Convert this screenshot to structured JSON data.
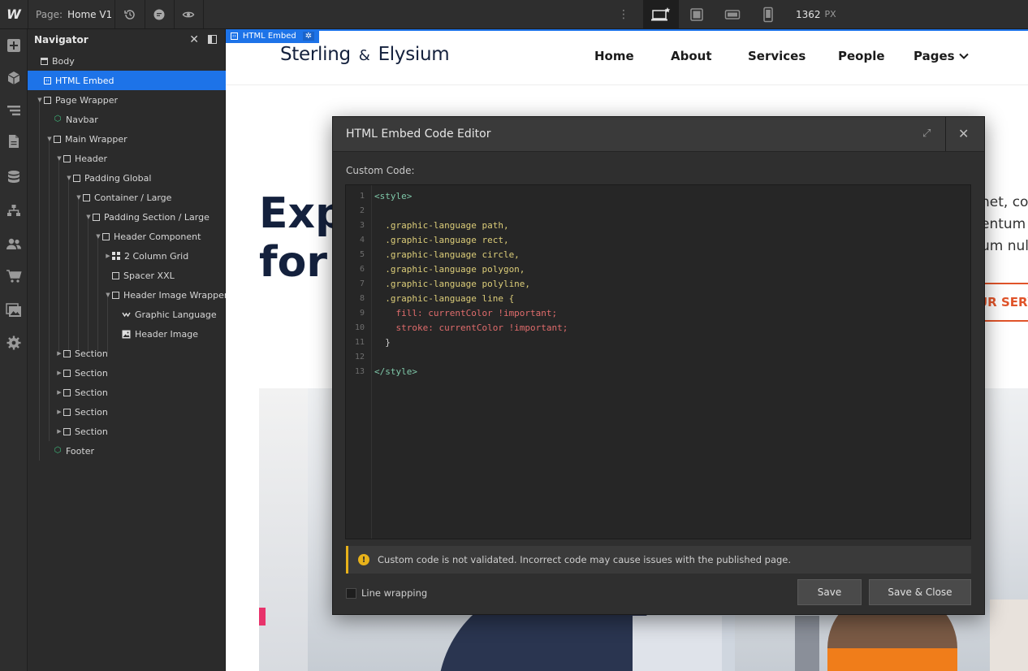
{
  "toolbar": {
    "logo": "W",
    "page_label": "Page:",
    "page_value": "Home V1",
    "more": "⋮",
    "width_value": "1362",
    "width_unit": "PX"
  },
  "navigator": {
    "title": "Navigator",
    "close": "✕",
    "rows": [
      {
        "label": "Body"
      },
      {
        "label": "HTML Embed"
      },
      {
        "label": "Page Wrapper"
      },
      {
        "label": "Navbar"
      },
      {
        "label": "Main Wrapper"
      },
      {
        "label": "Header"
      },
      {
        "label": "Padding Global"
      },
      {
        "label": "Container / Large"
      },
      {
        "label": "Padding Section / Large"
      },
      {
        "label": "Header Component"
      },
      {
        "label": "2 Column Grid"
      },
      {
        "label": "Spacer XXL"
      },
      {
        "label": "Header Image Wrapper"
      },
      {
        "label": "Graphic Language"
      },
      {
        "label": "Header Image"
      },
      {
        "label": "Section"
      },
      {
        "label": "Section"
      },
      {
        "label": "Section"
      },
      {
        "label": "Section"
      },
      {
        "label": "Section"
      },
      {
        "label": "Footer"
      }
    ]
  },
  "canvas": {
    "embed_tag": "HTML Embed",
    "brand_a": "Sterling",
    "brand_amp": "&",
    "brand_b": "Elysium",
    "menu": [
      "Home",
      "About",
      "Services",
      "People",
      "Pages"
    ],
    "hero_line1": "Exp",
    "hero_line2": "for",
    "hero_text": [
      "net, cor",
      "entum t",
      "um nul"
    ],
    "cta": "UR SERV"
  },
  "modal": {
    "title": "HTML Embed Code Editor",
    "expand": "⤢",
    "close": "✕",
    "custom_code_label": "Custom Code:",
    "code_lines": [
      "<style>",
      "",
      "  .graphic-language path,",
      "  .graphic-language rect,",
      "  .graphic-language circle,",
      "  .graphic-language polygon,",
      "  .graphic-language polyline,",
      "  .graphic-language line {",
      "    fill: currentColor !important;",
      "    stroke: currentColor !important;",
      "  }",
      "",
      "</style>"
    ],
    "line_numbers": [
      "1",
      "2",
      "3",
      "4",
      "5",
      "6",
      "7",
      "8",
      "9",
      "10",
      "11",
      "12",
      "13"
    ],
    "warning": "Custom code is not validated. Incorrect code may cause issues with the published page.",
    "line_wrapping_label": "Line wrapping",
    "save_label": "Save",
    "save_close_label": "Save & Close"
  },
  "colors": {
    "accent": "#1d73e8",
    "warning": "#e8b21a",
    "brand_navy": "#14213d",
    "cta_orange": "#e0542a"
  }
}
